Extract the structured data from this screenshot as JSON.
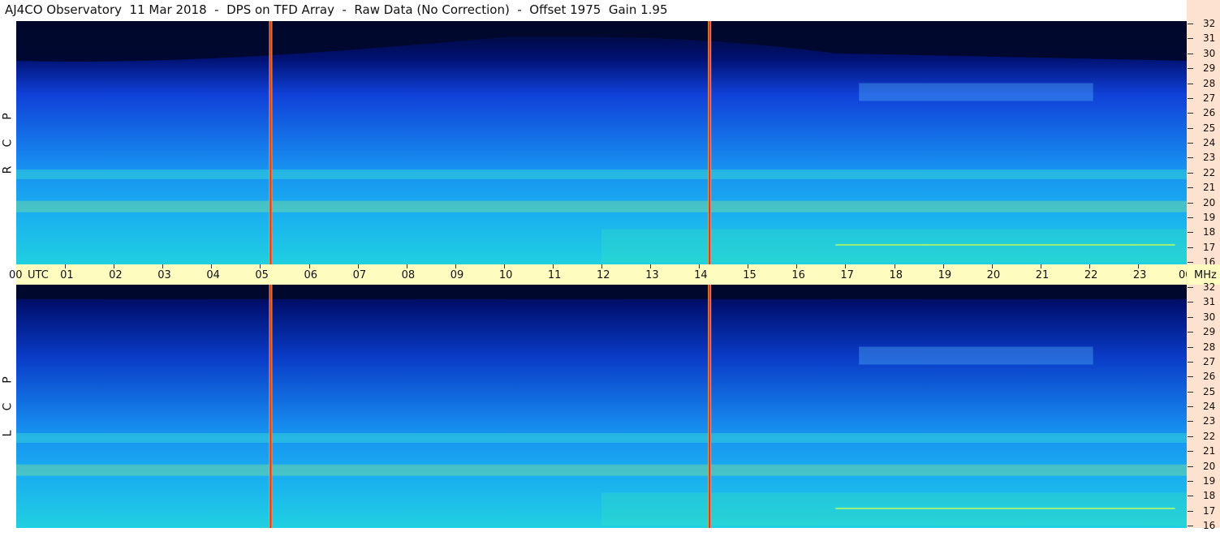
{
  "header": {
    "title": "AJ4CO Observatory  11 Mar 2018  -  DPS on TFD Array  -  Raw Data (No Correction)  -  Offset 1975  Gain 1.95"
  },
  "panels": {
    "top": {
      "label_chars": [
        "R",
        "C",
        "P"
      ]
    },
    "bottom": {
      "label_chars": [
        "L",
        "C",
        "P"
      ]
    }
  },
  "time_axis": {
    "start_label": "00",
    "unit_label": "UTC",
    "hour_labels": [
      "01",
      "02",
      "03",
      "04",
      "05",
      "06",
      "07",
      "08",
      "09",
      "10",
      "11",
      "12",
      "13",
      "14",
      "15",
      "16",
      "17",
      "18",
      "19",
      "20",
      "21",
      "22",
      "23",
      "00"
    ],
    "hours_total": 24
  },
  "freq_axis": {
    "unit_label": "MHz",
    "labels": [
      "32",
      "31",
      "30",
      "29",
      "28",
      "27",
      "26",
      "25",
      "24",
      "23",
      "22",
      "21",
      "20",
      "19",
      "18",
      "17",
      "16"
    ],
    "min": 16,
    "max": 32
  },
  "events": {
    "vertical_markers_utc": [
      5.2,
      14.2
    ]
  },
  "colors": {
    "background_deep": "#00082a",
    "spectrum_low": "#1040d8",
    "spectrum_mid": "#1790f0",
    "spectrum_high": "#20d0e0",
    "band_hot": "#9cf07a",
    "marker_orange": "#f0a040",
    "marker_red": "#e03030",
    "axis_time_bg": "#fffcc0",
    "axis_freq_bg": "#fde2cf"
  }
}
